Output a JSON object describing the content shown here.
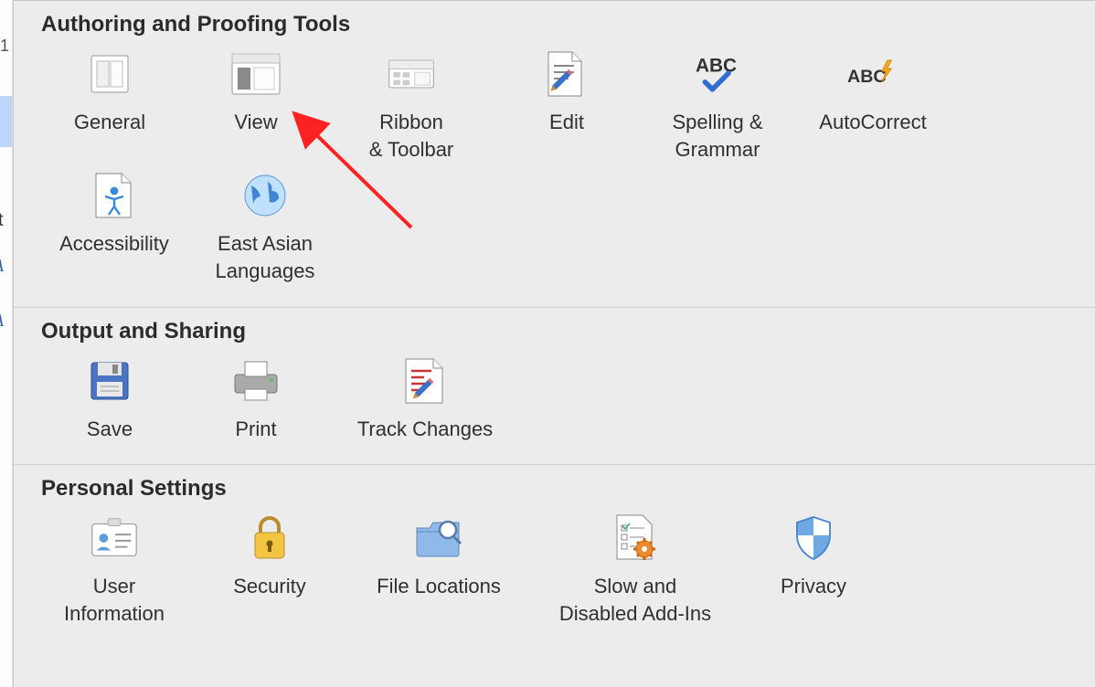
{
  "sections": {
    "authoring": {
      "heading": "Authoring and Proofing Tools",
      "items": {
        "general": "General",
        "view": "View",
        "ribbon_toolbar": "Ribbon\n& Toolbar",
        "edit": "Edit",
        "spelling_grammar": "Spelling &\nGrammar",
        "autocorrect": "AutoCorrect",
        "accessibility": "Accessibility",
        "east_asian_languages": "East Asian\nLanguages"
      }
    },
    "output": {
      "heading": "Output and Sharing",
      "items": {
        "save": "Save",
        "print": "Print",
        "track_changes": "Track Changes"
      }
    },
    "personal": {
      "heading": "Personal Settings",
      "items": {
        "user_information": "User\nInformation",
        "security": "Security",
        "file_locations": "File Locations",
        "slow_disabled_addins": "Slow and\nDisabled Add-Ins",
        "privacy": "Privacy"
      }
    }
  },
  "sidebar": {
    "line_number": "1",
    "glyph_t": "t",
    "glyph_a": "A"
  }
}
